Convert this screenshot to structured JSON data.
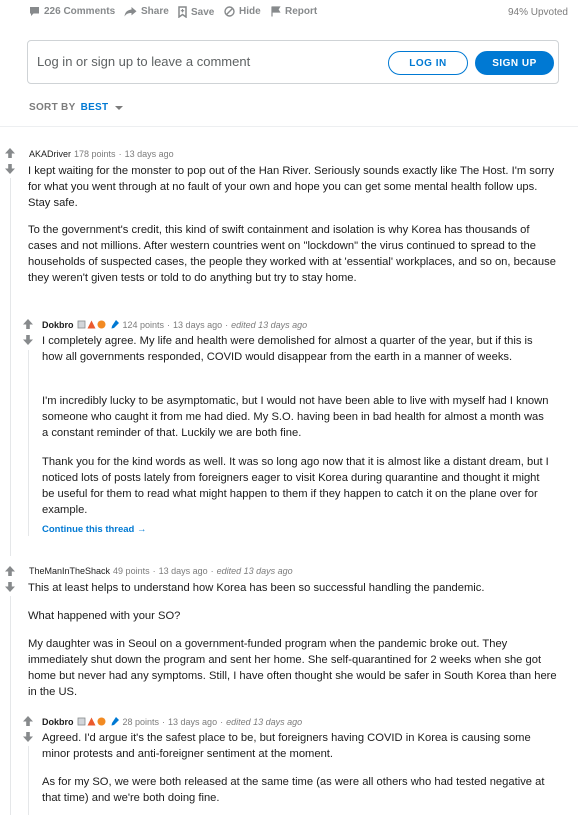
{
  "action_bar": {
    "comments": "226 Comments",
    "share": "Share",
    "save": "Save",
    "hide": "Hide",
    "report": "Report",
    "upvoted": "94% Upvoted"
  },
  "login_box": {
    "prompt": "Log in or sign up to leave a comment",
    "login_label": "LOG IN",
    "signup_label": "SIGN UP"
  },
  "sort": {
    "label": "SORT BY",
    "value": "BEST"
  },
  "comments": [
    {
      "author": "AKADriver",
      "points": "178 points",
      "time": "13 days ago",
      "paragraphs": [
        "I kept waiting for the monster to pop out of the Han River. Seriously sounds exactly like The Host. I'm sorry for what you went through at no fault of your own and hope you can get some mental health follow ups. Stay safe.",
        "To the government's credit, this kind of swift containment and isolation is why Korea has thousands of cases and not millions. After western countries went on \"lockdown\" the virus continued to spread to the households of suspected cases, the people they worked with at 'essential' workplaces, and so on, because they weren't given tests or told to do anything but try to stay home."
      ]
    },
    {
      "author": "Dokbro",
      "points": "124 points",
      "time": "13 days ago",
      "edited": "edited 13 days ago",
      "paragraphs": [
        "I completely agree. My life and health were demolished for almost a quarter of the year, but if this is how all governments responded, COVID would disappear from the earth in a manner of weeks.",
        "I'm incredibly lucky to be asymptomatic, but I would not have been able to live with myself had I known someone who caught it from me had died. My S.O. having been in bad health for almost a month was a constant reminder of that. Luckily we are both fine.",
        "Thank you for the kind words as well. It was so long ago now that it is almost like a distant dream, but I noticed lots of posts lately from foreigners eager to visit Korea during quarantine and thought it might be useful for them to read what might happen to them if they happen to catch it on the plane over for example."
      ],
      "continue": "Continue this thread →"
    },
    {
      "author": "TheManInTheShack",
      "points": "49 points",
      "time": "13 days ago",
      "edited": "edited 13 days ago",
      "paragraphs": [
        "This at least helps to understand how Korea has been so successful handling the pandemic.",
        "What happened with your SO?",
        "My daughter was in Seoul on a government-funded program when the pandemic broke out. They immediately shut down the program and sent her home. She self-quarantined for 2 weeks when she got home but never had any symptoms. Still, I have often thought she would be safer in South Korea than here in the US."
      ]
    },
    {
      "author": "Dokbro",
      "points": "28 points",
      "time": "13 days ago",
      "edited": "edited 13 days ago",
      "paragraphs": [
        "Agreed. I'd argue it's the safest place to be, but foreigners having COVID in Korea is causing some minor protests and anti-foreigner sentiment at the moment.",
        "As for my SO, we were both released at the same time (as were all others who had tested negative at that time) and we're both doing fine."
      ]
    }
  ],
  "dot": "·",
  "colors": {
    "accent": "#0079d3",
    "muted": "#878a8c",
    "thread": "#e5e7e9"
  }
}
